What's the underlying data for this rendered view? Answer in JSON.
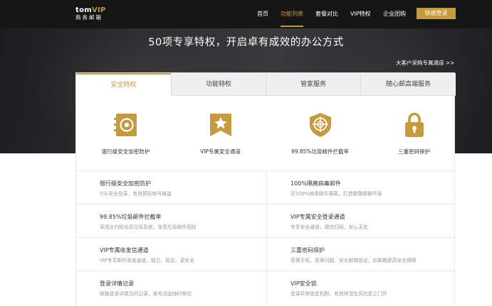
{
  "header": {
    "logo_line1": "tom",
    "logo_vip": "VIP",
    "logo_line2": "商务邮箱",
    "nav": [
      {
        "label": "首页"
      },
      {
        "label": "功能列表"
      },
      {
        "label": "套餐对比"
      },
      {
        "label": "VIP特权"
      },
      {
        "label": "企业团购"
      }
    ],
    "login_label": "快速登录"
  },
  "hero": {
    "title": "50项专享特权，开启卓有成效的办公方式",
    "enterprise_link": "大客户采购专属通道 >>"
  },
  "tabs": [
    {
      "label": "安全特权",
      "active": true
    },
    {
      "label": "功能特权",
      "active": false
    },
    {
      "label": "管家服务",
      "active": false
    },
    {
      "label": "随心邮高端服务",
      "active": false
    }
  ],
  "features": [
    {
      "icon": "safe-icon",
      "label": "银行级安全加密防护"
    },
    {
      "icon": "star-badge-icon",
      "label": "VIP专属安全通道"
    },
    {
      "icon": "shield-target-icon",
      "label": "99.85%垃圾邮件拦截率"
    },
    {
      "icon": "lock-icon",
      "label": "三重密码保护"
    }
  ],
  "list": [
    {
      "title": "银行级安全加密防护",
      "desc": "SSL安全登录、有效预防帐号被盗"
    },
    {
      "title": "100%隔离病毒邮件",
      "desc": "近100%病毒邮件隔离，打造健康邮箱环境"
    },
    {
      "title": "99.85%垃圾邮件拦截率",
      "desc": "采用业内知名反垃圾系统，免受垃圾邮件困扰"
    },
    {
      "title": "VIP专属安全登录通道",
      "desc": "专享安全通道，微信扫码，安心无忧"
    },
    {
      "title": "VIP专属收发信通道",
      "desc": "VIP专享邮件收发通道，独立、稳定、更安全"
    },
    {
      "title": "三重密码保护",
      "desc": "密保手机、密保问题、安全邮箱验证，给邮箱更高安全保障"
    },
    {
      "title": "登录详情记录",
      "desc": "邮箱登录详情及时记录，账号动态随时掌控"
    },
    {
      "title": "VIP安全锁",
      "desc": "登录异常锁定机制，有效将潜在风险拒之门外"
    }
  ],
  "colors": {
    "accent": "#c69a3e",
    "topbar": "#151515"
  }
}
